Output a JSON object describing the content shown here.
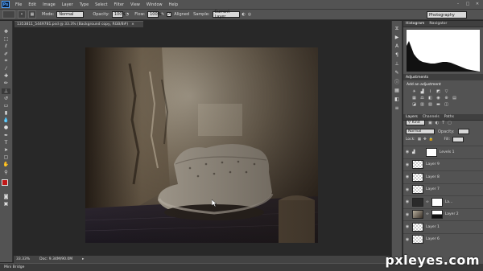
{
  "app": {
    "logo": "Ps",
    "menu": [
      "File",
      "Edit",
      "Image",
      "Layer",
      "Type",
      "Select",
      "Filter",
      "View",
      "Window",
      "Help"
    ],
    "window_controls": [
      "–",
      "□",
      "✕"
    ]
  },
  "options": {
    "mode_label": "Mode:",
    "mode_value": "Normal",
    "opacity_label": "Opacity:",
    "opacity_value": "100%",
    "flow_label": "Flow:",
    "flow_value": "100%",
    "aligned_label": "Aligned",
    "sample_label": "Sample:",
    "sample_value": "Current Layer",
    "workspace": "Photography"
  },
  "document": {
    "tab_title": "1353811_5449781.psd @ 33.3% (Background copy, RGB/8#)",
    "close": "×"
  },
  "status": {
    "zoom": "33.33%",
    "doc_size": "Doc: 9.34M/90.0M"
  },
  "minibridge": "Mini Bridge",
  "panels": {
    "histogram_tab": "Histogram",
    "navigator_tab": "Navigator",
    "adjustments_tab": "Adjustments",
    "add_adjustment": "Add an adjustment",
    "layers_tabs": [
      "Layers",
      "Channels",
      "Paths"
    ],
    "kind_label": "Kind",
    "blend_mode": "Normal",
    "opacity_label": "Opacity:",
    "lock_label": "Lock:",
    "fill_label": "Fill:",
    "layers": [
      {
        "name": "Levels 1",
        "thumb": "white",
        "mask": true
      },
      {
        "name": "Layer 9",
        "thumb": "checker"
      },
      {
        "name": "Layer 8",
        "thumb": "checker"
      },
      {
        "name": "Layer 7",
        "thumb": "checker"
      },
      {
        "name": "La...",
        "thumb": "white",
        "mask": true
      },
      {
        "name": "Layer 2",
        "thumb": "dark",
        "mask": true
      },
      {
        "name": "Layer 1",
        "thumb": "checker"
      },
      {
        "name": "Layer 6",
        "thumb": "checker"
      }
    ]
  },
  "watermark": "pxleyes.com",
  "colors": {
    "menu_bg": "#535353",
    "canvas_bg": "#282828",
    "foreground_swatch": "#c01818",
    "background_swatch": "#ffffff"
  }
}
